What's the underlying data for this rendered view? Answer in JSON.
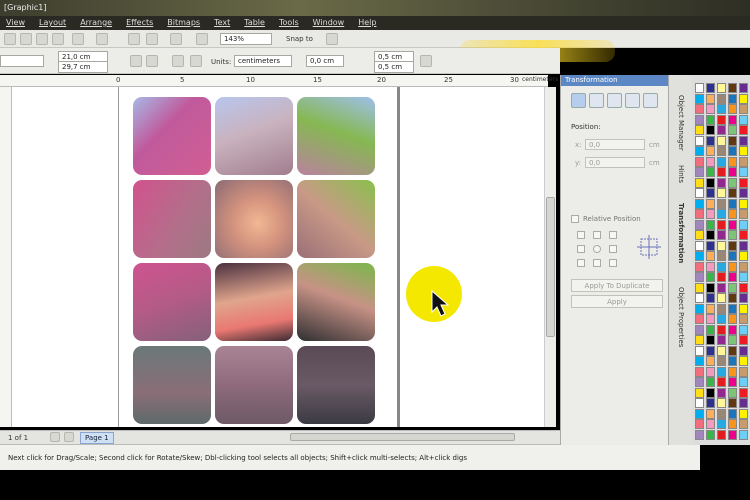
{
  "window": {
    "title": "[Graphic1]"
  },
  "menu": [
    "View",
    "Layout",
    "Arrange",
    "Effects",
    "Bitmaps",
    "Text",
    "Table",
    "Tools",
    "Window",
    "Help"
  ],
  "toolbar": {
    "zoom": "143%",
    "snap_to": "Snap to"
  },
  "property_bar": {
    "width": "21,0 cm",
    "height": "29,7 cm",
    "units_label": "Units:",
    "units_value": "centimeters",
    "nudge": "0,0 cm",
    "dup_x": "0,5 cm",
    "dup_y": "0,5 cm"
  },
  "ruler": {
    "ticks": [
      "0",
      "5",
      "10",
      "15",
      "20",
      "25",
      "30"
    ],
    "unit": "centimeters"
  },
  "docker": {
    "title": "Transformation",
    "position_label": "Position:",
    "x_label": "x:",
    "x_value": "0,0",
    "x_unit": "cm",
    "y_label": "y:",
    "y_value": "0,0",
    "y_unit": "cm",
    "relative_label": "Relative Position",
    "apply_duplicate": "Apply To Duplicate",
    "apply": "Apply"
  },
  "side_tabs": [
    "Object Manager",
    "Hints",
    "Transformation",
    "Object Properties"
  ],
  "page_nav": {
    "count": "1 of 1",
    "page_tab": "Page 1"
  },
  "status": {
    "hint": "Next click for Drag/Scale; Second click for Rotate/Skew; Dbl-clicking tool selects all objects; Shift+click multi-selects; Alt+click digs"
  },
  "colors": {
    "accent": "#5b88c4",
    "cursor_highlight": "#f5e800",
    "palette": [
      "#ffffff",
      "#000000",
      "#e31d1d",
      "#f7941d",
      "#fff200",
      "#00a651",
      "#00aeef",
      "#2e3192",
      "#92278f",
      "#ec008c",
      "#c69c6d",
      "#8c6239",
      "#f26d7d",
      "#fbaf5d",
      "#fff799",
      "#7cc576",
      "#6dcff6",
      "#8393ca",
      "#a186be",
      "#f49ac1",
      "#998675",
      "#603913",
      "#ed1c24",
      "#f7941d",
      "#ffde17",
      "#39b54a",
      "#27aae1",
      "#1b75bc",
      "#662d91",
      "#d7197f"
    ]
  }
}
